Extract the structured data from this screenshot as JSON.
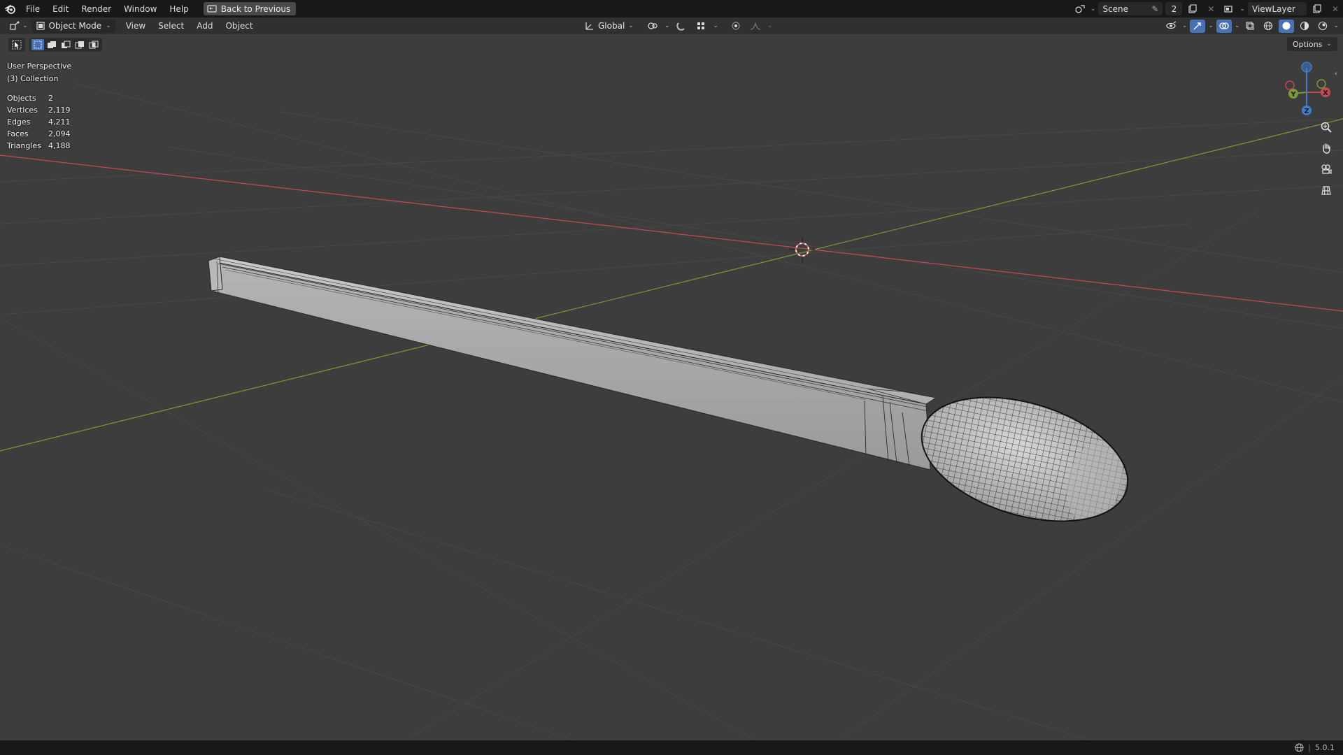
{
  "menu": {
    "file": "File",
    "edit": "Edit",
    "render": "Render",
    "window": "Window",
    "help": "Help",
    "back_to_previous": "Back to Previous"
  },
  "topbar_right": {
    "scene_label": "Scene",
    "scene_users": "2",
    "viewlayer_label": "ViewLayer"
  },
  "header": {
    "mode": "Object Mode",
    "view": "View",
    "select": "Select",
    "add": "Add",
    "object": "Object",
    "transform_orientation": "Global"
  },
  "options_label": "Options",
  "overlay": {
    "perspective": "User Perspective",
    "collection": "(3) Collection",
    "stats": [
      {
        "label": "Objects",
        "value": "2"
      },
      {
        "label": "Vertices",
        "value": "2,119"
      },
      {
        "label": "Edges",
        "value": "4,211"
      },
      {
        "label": "Faces",
        "value": "2,094"
      },
      {
        "label": "Triangles",
        "value": "4,188"
      }
    ]
  },
  "gizmo": {
    "x": "X",
    "y": "Y",
    "z": "Z"
  },
  "status": {
    "version": "5.0.1"
  },
  "colors": {
    "viewport_bg": "#3d3d3d",
    "x_axis": "#c44a52",
    "y_axis": "#7a9a38",
    "z_axis": "#3a7fd0",
    "grid": "#474747"
  }
}
